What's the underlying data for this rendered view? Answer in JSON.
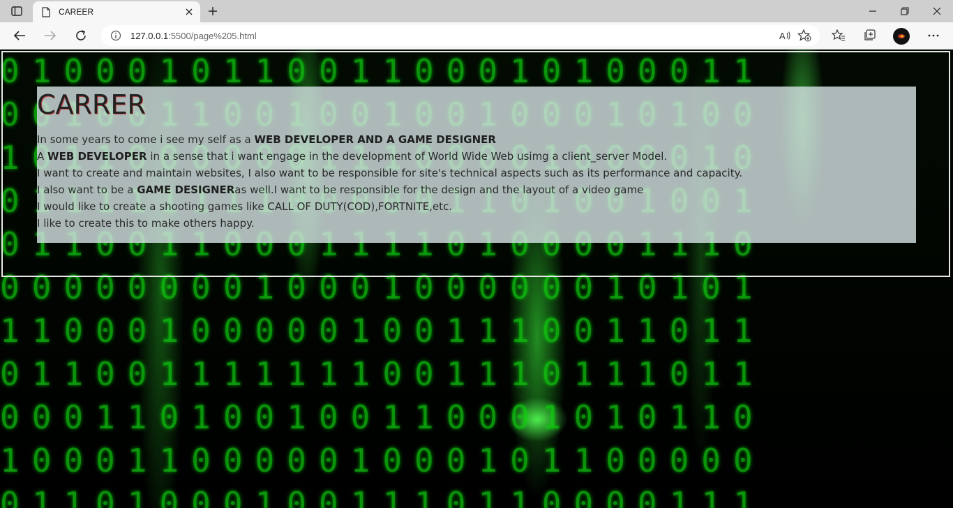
{
  "browser": {
    "tab_title": "CAREER",
    "url_host": "127.0.0.1",
    "url_path": ":5500/page%205.html"
  },
  "page": {
    "heading": "CARRER",
    "line1_prefix": "In some years to come i see my self as a ",
    "line1_bold": "WEB DEVELOPER AND A GAME DESIGNER",
    "line2_prefix": "A ",
    "line2_bold": "WEB DEVELOPER",
    "line2_suffix": " in a sense that i want engage in the development of World Wide Web usimg a client_server Model.",
    "line3": "I want to create and maintain websites, I also want to be responsible for site's technical aspects such as its performance and capacity.",
    "line4_prefix": "I also want to be a ",
    "line4_bold": "GAME DESIGNER",
    "line4_suffix": "as well.I want to be responsible for the design and the layout of a video game",
    "line5": "I would like to create a shooting games like CALL OF DUTY(COD),FORTNITE,etc.",
    "line6": "I like to create this to make others happy."
  },
  "colors": {
    "tabbar": "#cfcfcf",
    "toolbar": "#f7f7f7",
    "matrix_green": "#14c814",
    "card_bg": "#d2e1e1"
  },
  "icons": {
    "tab_actions": "tab-actions-icon",
    "favicon": "page-icon",
    "close": "close-icon",
    "new_tab": "plus-icon",
    "back": "back-arrow-icon",
    "forward": "forward-arrow-icon",
    "refresh": "refresh-icon",
    "info": "info-icon",
    "read_aloud": "read-aloud-icon",
    "add_favorite": "add-favorite-icon",
    "favorites": "favorites-icon",
    "collections": "collections-icon",
    "more": "more-icon"
  }
}
